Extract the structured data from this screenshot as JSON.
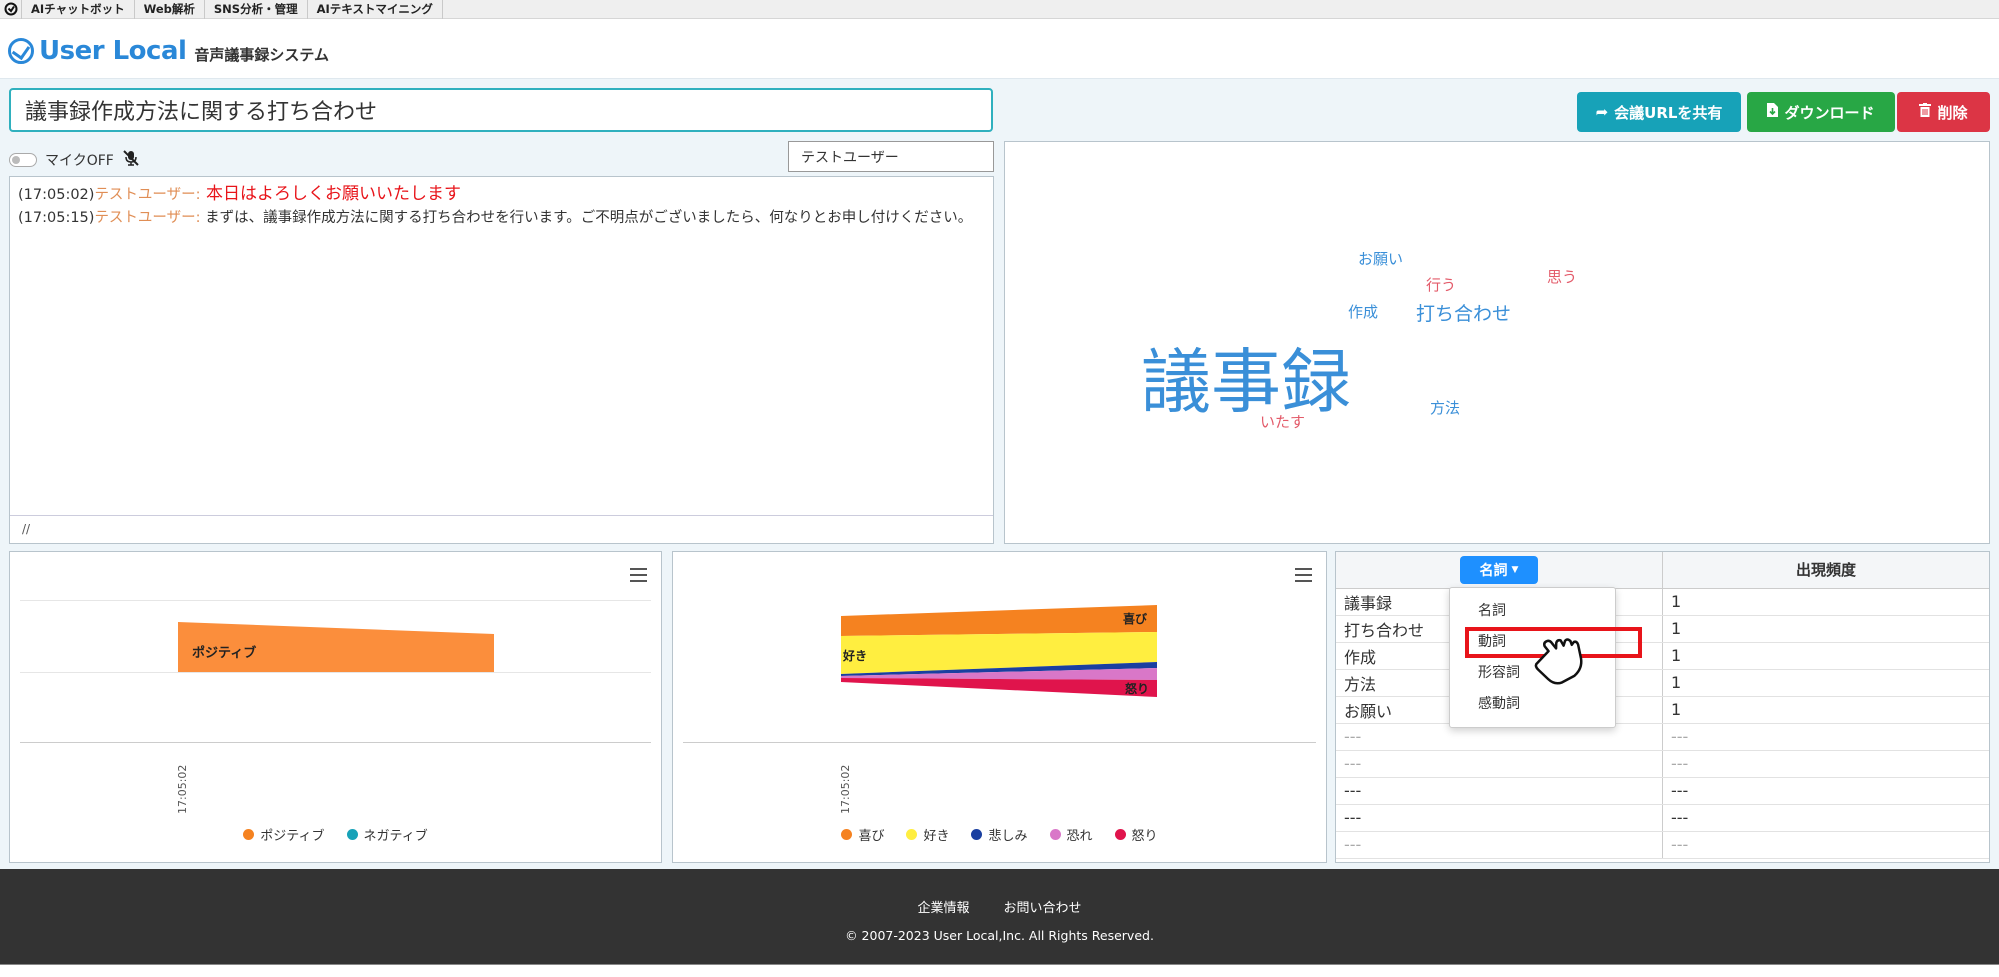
{
  "topnav": {
    "links": [
      "AIチャットボット",
      "Web解析",
      "SNS分析・管理",
      "AIテキストマイニング"
    ]
  },
  "header": {
    "brand": "User Local",
    "product": "音声議事録システム",
    "brand_color": "#2a88d8"
  },
  "meeting": {
    "title": "議事録作成方法に関する打ち合わせ",
    "share_label": "会議URLを共有",
    "download_label": "ダウンロード",
    "delete_label": "削除",
    "mic_label": "マイクOFF",
    "speaker": "テストユーザー"
  },
  "transcript": [
    {
      "time": "(17:05:02)",
      "speaker": "テストユーザー:",
      "text": " 本日はよろしくお願いいたします"
    },
    {
      "time": "(17:05:15)",
      "speaker": "テストユーザー:",
      "text": " まずは、議事録作成方法に関する打ち合わせを行います。ご不明点がございましたら、何なりとお申し付けください。"
    }
  ],
  "transcript_footer": "//",
  "wordcloud": [
    {
      "word": "お願い",
      "color": "#3a8fd8"
    },
    {
      "word": "行う",
      "color": "#e35b6a"
    },
    {
      "word": "思う",
      "color": "#e35b6a"
    },
    {
      "word": "作成",
      "color": "#3a8fd8"
    },
    {
      "word": "打ち合わせ",
      "color": "#3a8fd8"
    },
    {
      "word": "議事録",
      "color": "#3a8fd8"
    },
    {
      "word": "方法",
      "color": "#3a8fd8"
    },
    {
      "word": "いたす",
      "color": "#e35b6a"
    }
  ],
  "sentiment_chart": {
    "chart_data": {
      "type": "area",
      "x": [
        "17:05:02"
      ],
      "series": [
        {
          "name": "ポジティブ",
          "values": [
            1
          ]
        },
        {
          "name": "ネガティブ",
          "values": [
            0
          ]
        }
      ],
      "legend": "bottom"
    },
    "area_label": "ポジティブ",
    "legend": [
      {
        "name": "ポジティブ",
        "color": "#f58220"
      },
      {
        "name": "ネガティブ",
        "color": "#17a2b8"
      }
    ]
  },
  "emotion_chart": {
    "chart_data": {
      "type": "area",
      "x": [
        "17:05:02"
      ],
      "series": [
        {
          "name": "喜び"
        },
        {
          "name": "好き"
        },
        {
          "name": "悲しみ"
        },
        {
          "name": "恐れ"
        },
        {
          "name": "怒り"
        }
      ],
      "legend": "bottom"
    },
    "labels": {
      "joy": "喜び",
      "like": "好き",
      "anger": "怒り"
    },
    "legend": [
      {
        "name": "喜び",
        "color": "#f58220"
      },
      {
        "name": "好き",
        "color": "#ffee40"
      },
      {
        "name": "悲しみ",
        "color": "#1a3fa0"
      },
      {
        "name": "恐れ",
        "color": "#d977c8"
      },
      {
        "name": "怒り",
        "color": "#e0144c"
      }
    ]
  },
  "frequency": {
    "pos_selected": "名詞",
    "count_header": "出現頻度",
    "menu": [
      "名詞",
      "動詞",
      "形容詞",
      "感動詞"
    ],
    "highlight_index": 1,
    "rows": [
      {
        "word": "議事録",
        "count": "1"
      },
      {
        "word": "打ち合わせ",
        "count": "1"
      },
      {
        "word": "作成",
        "count": "1"
      },
      {
        "word": "方法",
        "count": "1"
      },
      {
        "word": "お願い",
        "count": "1"
      },
      {
        "word": "---",
        "count": "---"
      },
      {
        "word": "---",
        "count": "---"
      },
      {
        "word": "---",
        "count": "---"
      },
      {
        "word": "---",
        "count": "---"
      },
      {
        "word": "---",
        "count": "---"
      }
    ]
  },
  "footer": {
    "company": "企業情報",
    "contact": "お問い合わせ",
    "copyright": "© 2007-2023 User Local,Inc. All Rights Reserved."
  }
}
